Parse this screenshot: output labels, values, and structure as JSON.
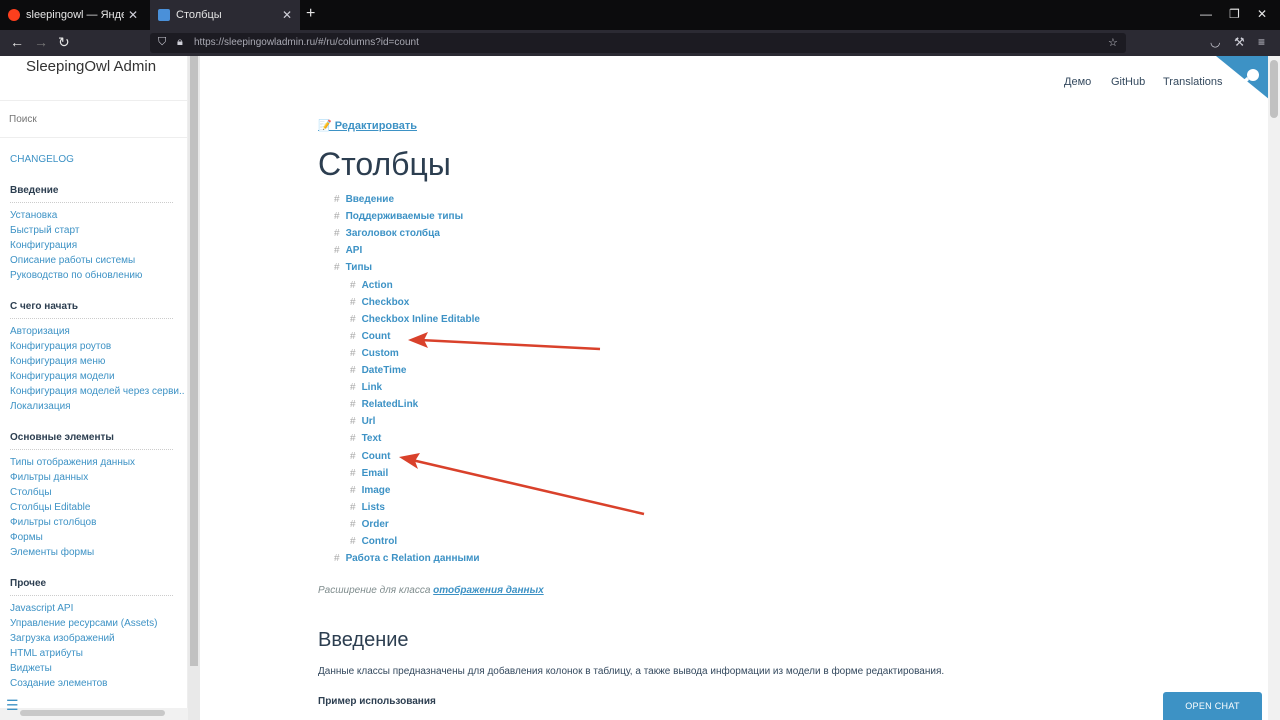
{
  "browser": {
    "tabs": [
      {
        "title": "sleepingowl — Яндекс: нашлось",
        "favicon_color": "#fc3f1d"
      },
      {
        "title": "Столбцы",
        "favicon_color": "#4a90d9"
      }
    ],
    "url": "https://sleepingowladmin.ru/#/ru/columns?id=count"
  },
  "sidebar": {
    "title": "SleepingOwl Admin",
    "search_placeholder": "Поиск",
    "changelog": "CHANGELOG",
    "sections": [
      {
        "heading": "Введение",
        "items": [
          "Установка",
          "Быстрый старт",
          "Конфигурация",
          "Описание работы системы",
          "Руководство по обновлению"
        ]
      },
      {
        "heading": "С чего начать",
        "items": [
          "Авторизация",
          "Конфигурация роутов",
          "Конфигурация меню",
          "Конфигурация модели",
          "Конфигурация моделей через серви..",
          "Локализация"
        ]
      },
      {
        "heading": "Основные элементы",
        "items": [
          "Типы отображения данных",
          "Фильтры данных",
          "Столбцы",
          "Столбцы Editable",
          "Фильтры столбцов",
          "Формы",
          "Элементы формы"
        ]
      },
      {
        "heading": "Прочее",
        "items": [
          "Javascript API",
          "Управление ресурсами (Assets)",
          "Загрузка изображений",
          "HTML атрибуты",
          "Виджеты",
          "Создание элементов"
        ]
      }
    ]
  },
  "topnav": {
    "demo": "Демо",
    "github": "GitHub",
    "translations": "Translations"
  },
  "content": {
    "edit_link": "📝 Редактировать",
    "title": "Столбцы",
    "toc": [
      {
        "label": "Введение",
        "level": 0
      },
      {
        "label": "Поддерживаемые типы",
        "level": 0
      },
      {
        "label": "Заголовок столбца",
        "level": 0
      },
      {
        "label": "API",
        "level": 0
      },
      {
        "label": "Типы",
        "level": 0
      },
      {
        "label": "Action",
        "level": 1
      },
      {
        "label": "Checkbox",
        "level": 1
      },
      {
        "label": "Checkbox Inline Editable",
        "level": 1
      },
      {
        "label": "Count",
        "level": 1
      },
      {
        "label": "Custom",
        "level": 1
      },
      {
        "label": "DateTime",
        "level": 1
      },
      {
        "label": "Link",
        "level": 1
      },
      {
        "label": "RelatedLink",
        "level": 1
      },
      {
        "label": "Url",
        "level": 1
      },
      {
        "label": "Text",
        "level": 1
      },
      {
        "label": "Count",
        "level": 1
      },
      {
        "label": "Email",
        "level": 1
      },
      {
        "label": "Image",
        "level": 1
      },
      {
        "label": "Lists",
        "level": 1
      },
      {
        "label": "Order",
        "level": 1
      },
      {
        "label": "Control",
        "level": 1
      },
      {
        "label": "Работа с Relation данными",
        "level": 0
      }
    ],
    "toc_hash": "#",
    "note_prefix": "Расширение для класса ",
    "note_link": "отображения данных",
    "section_title": "Введение",
    "paragraph": "Данные классы предназначены для добавления колонок в таблицу, а также вывода информации из модели в форме редактирования.",
    "example_heading": "Пример использования"
  },
  "chat_button": "OPEN CHAT",
  "colors": {
    "accent": "#3d92c5",
    "arrow": "#d9412b"
  }
}
